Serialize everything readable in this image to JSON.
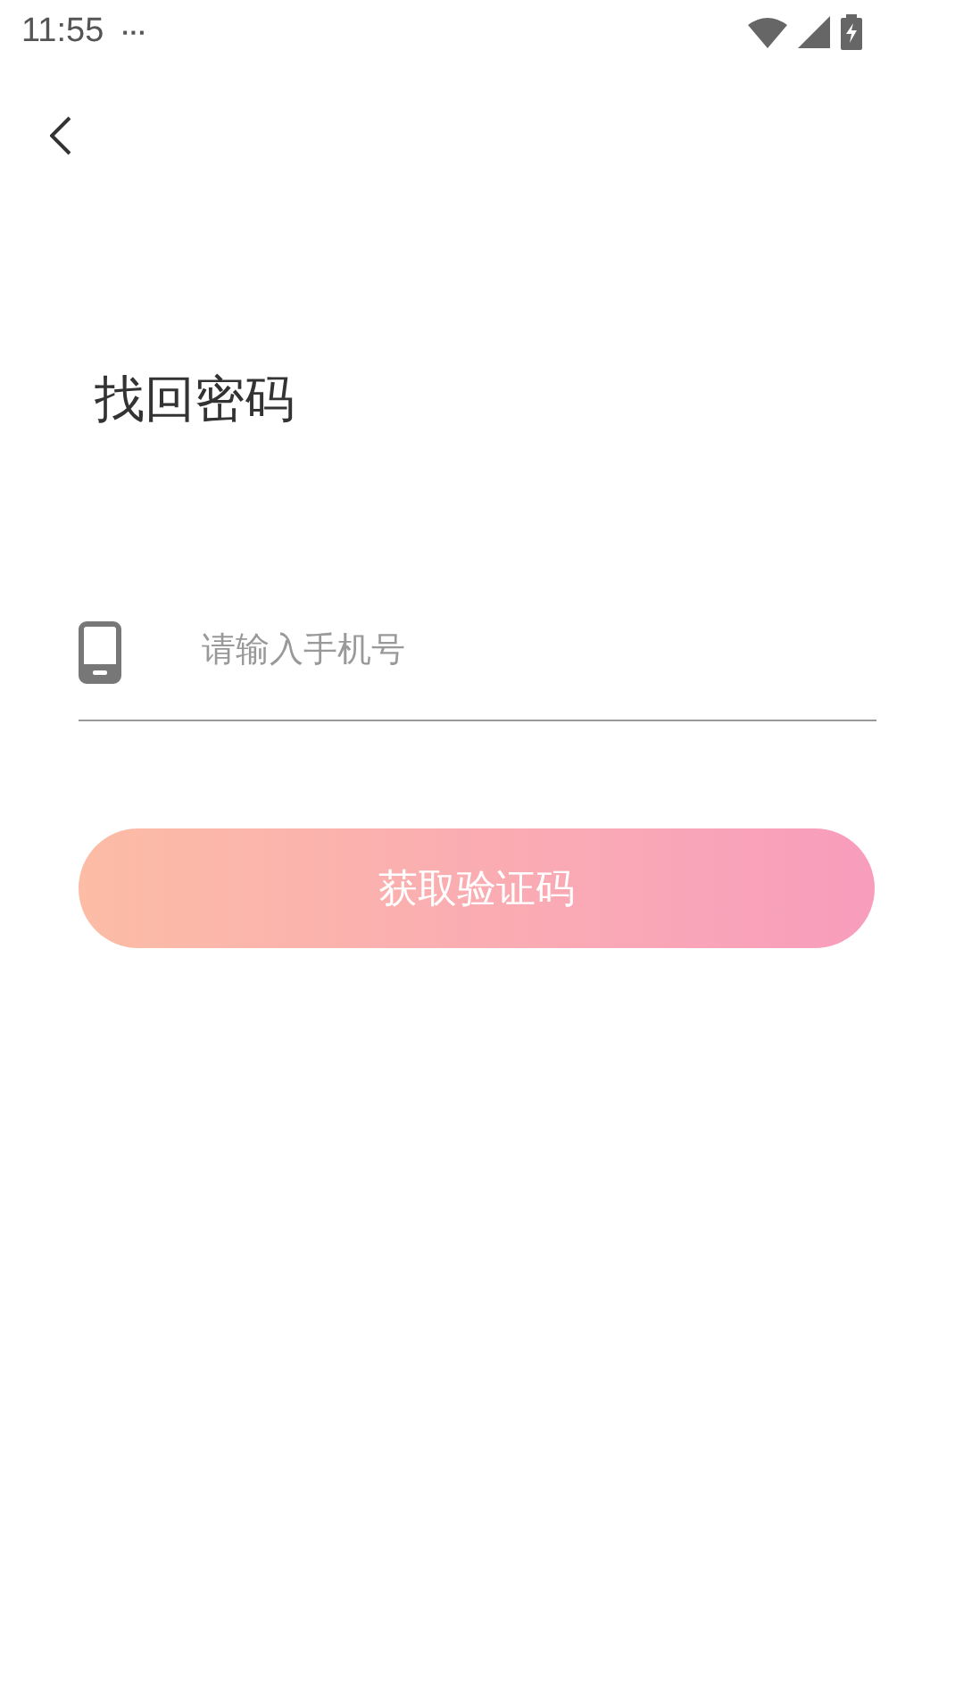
{
  "status_bar": {
    "time": "11:55",
    "more": "···"
  },
  "title": "找回密码",
  "phone_field": {
    "placeholder": "请输入手机号"
  },
  "submit_button": {
    "label": "获取验证码"
  }
}
